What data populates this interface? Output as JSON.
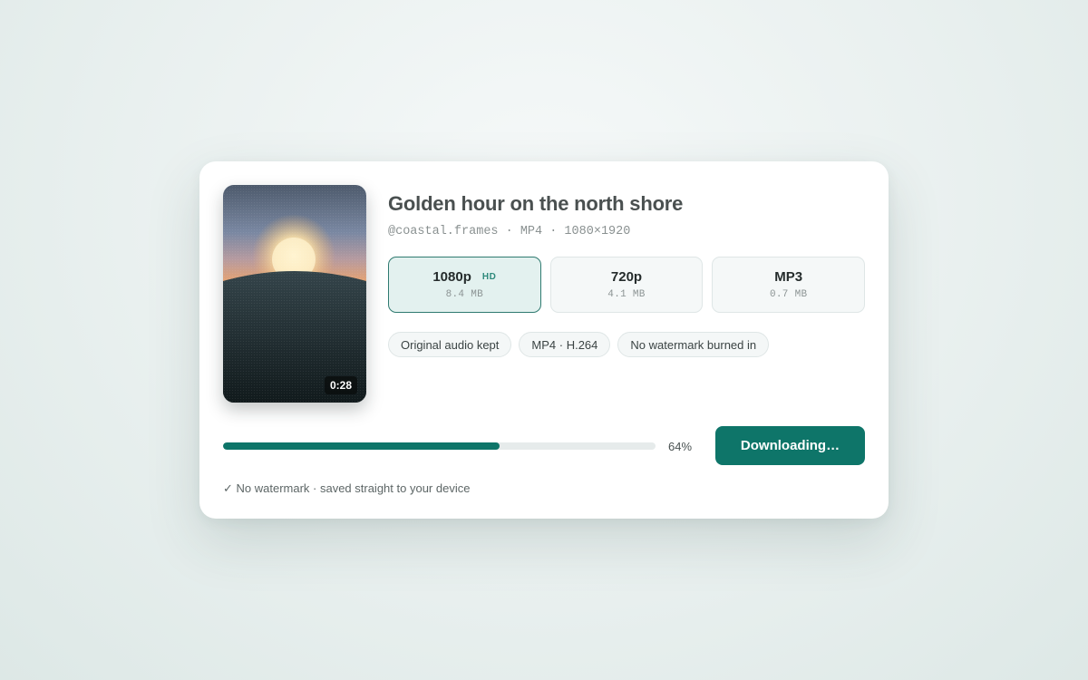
{
  "video": {
    "title": "Golden hour on the north shore",
    "meta": "@coastal.frames · MP4 · 1080×1920",
    "duration": "0:28"
  },
  "formats": [
    {
      "label": "1080p",
      "badge": "HD",
      "size": "8.4 MB",
      "selected": true
    },
    {
      "label": "720p",
      "size": "4.1 MB",
      "selected": false
    },
    {
      "label": "MP3",
      "size": "0.7 MB",
      "selected": false
    }
  ],
  "chips": [
    "Original audio kept",
    "MP4 · H.264",
    "No watermark burned in"
  ],
  "download": {
    "progress_percent": 64,
    "progress_label": "64%",
    "button_label": "Downloading…"
  },
  "footnote": "✓ No watermark · saved straight to your device",
  "colors": {
    "accent": "#0e7569",
    "selected_background": "#e3f1ef",
    "track": "#e6ebeb"
  },
  "icons": {
    "thumbnail_scene": "sunset-over-hill"
  }
}
